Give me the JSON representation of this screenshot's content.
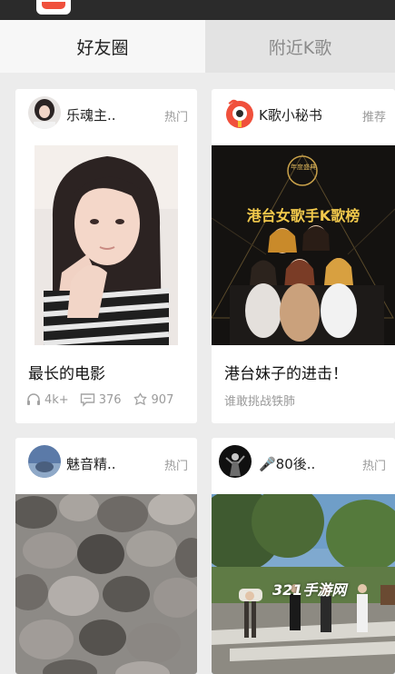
{
  "tabs": {
    "friends": "好友圈",
    "nearby": "附近K歌"
  },
  "feed": {
    "cards": [
      {
        "author": "乐魂主..",
        "tag": "热门",
        "avatar_icon": "user-avatar",
        "title": "最长的电影",
        "stats": {
          "listens": "4k+",
          "comments": "376",
          "gifts": "907"
        }
      },
      {
        "author": "K歌小秘书",
        "tag": "推荐",
        "avatar_icon": "karaoke-bot-avatar",
        "title": "港台妹子的进击！",
        "subtitle": "谁敢挑战铁肺",
        "poster": {
          "badge": "年度盛典",
          "headline": "港台女歌手K歌榜"
        }
      },
      {
        "author": "魅音精..",
        "tag": "热门",
        "avatar_icon": "user-avatar"
      },
      {
        "author": "🎤80後..",
        "tag": "热门",
        "avatar_icon": "user-avatar"
      }
    ]
  },
  "watermark": "321手游网",
  "colors": {
    "accent": "#f0503c",
    "poster_gold": "#f2c94c",
    "muted_text": "#9a9a9a"
  }
}
